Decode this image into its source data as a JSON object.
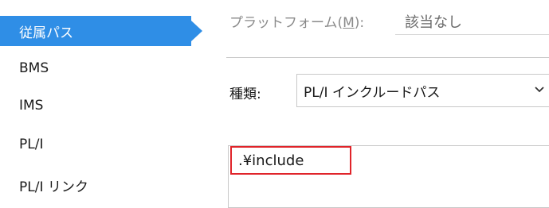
{
  "sidebar": {
    "items": [
      {
        "label": "従属パス",
        "selected": true
      },
      {
        "label": "BMS",
        "selected": false
      },
      {
        "label": "IMS",
        "selected": false
      },
      {
        "label": "PL/I",
        "selected": false
      },
      {
        "label": "PL/I リンク",
        "selected": false
      }
    ]
  },
  "platform": {
    "label_prefix": "プラットフォーム(",
    "label_mnemonic": "M",
    "label_suffix": "):",
    "value": "該当なし"
  },
  "kind": {
    "label": "種類:",
    "selected": "PL/I インクルードパス"
  },
  "paths": {
    "items": [
      ".¥include"
    ]
  },
  "colors": {
    "selected_bg": "#2f8ee6",
    "highlight_border": "#e0242a"
  }
}
